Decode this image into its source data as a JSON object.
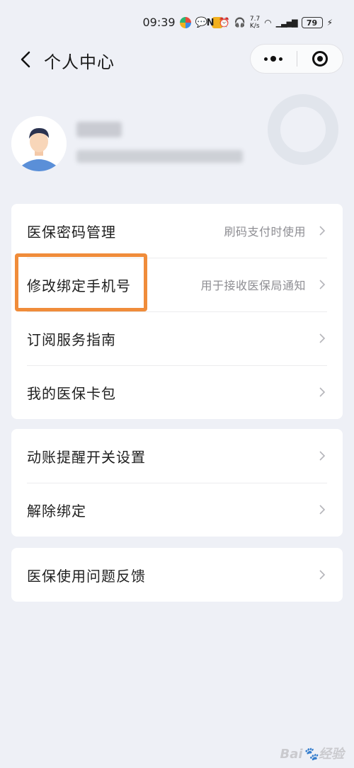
{
  "status_bar": {
    "time": "09:39",
    "net_speed_value": "7.7",
    "net_speed_unit": "K/s",
    "battery": "79"
  },
  "nav": {
    "title": "个人中心",
    "back_icon": "chevron-left-icon",
    "more_icon": "more-dots-icon",
    "close_icon": "target-icon"
  },
  "groups": [
    {
      "items": [
        {
          "label": "医保密码管理",
          "hint": "刷码支付时使用"
        },
        {
          "label": "修改绑定手机号",
          "hint": "用于接收医保局通知"
        },
        {
          "label": "订阅服务指南",
          "hint": ""
        },
        {
          "label": "我的医保卡包",
          "hint": ""
        }
      ]
    },
    {
      "items": [
        {
          "label": "动账提醒开关设置",
          "hint": ""
        },
        {
          "label": "解除绑定",
          "hint": ""
        }
      ]
    },
    {
      "items": [
        {
          "label": "医保使用问题反馈",
          "hint": ""
        }
      ]
    }
  ],
  "colors": {
    "background": "#eef0f6",
    "highlight": "#f08c3a",
    "hint_text": "#8e8e93"
  }
}
